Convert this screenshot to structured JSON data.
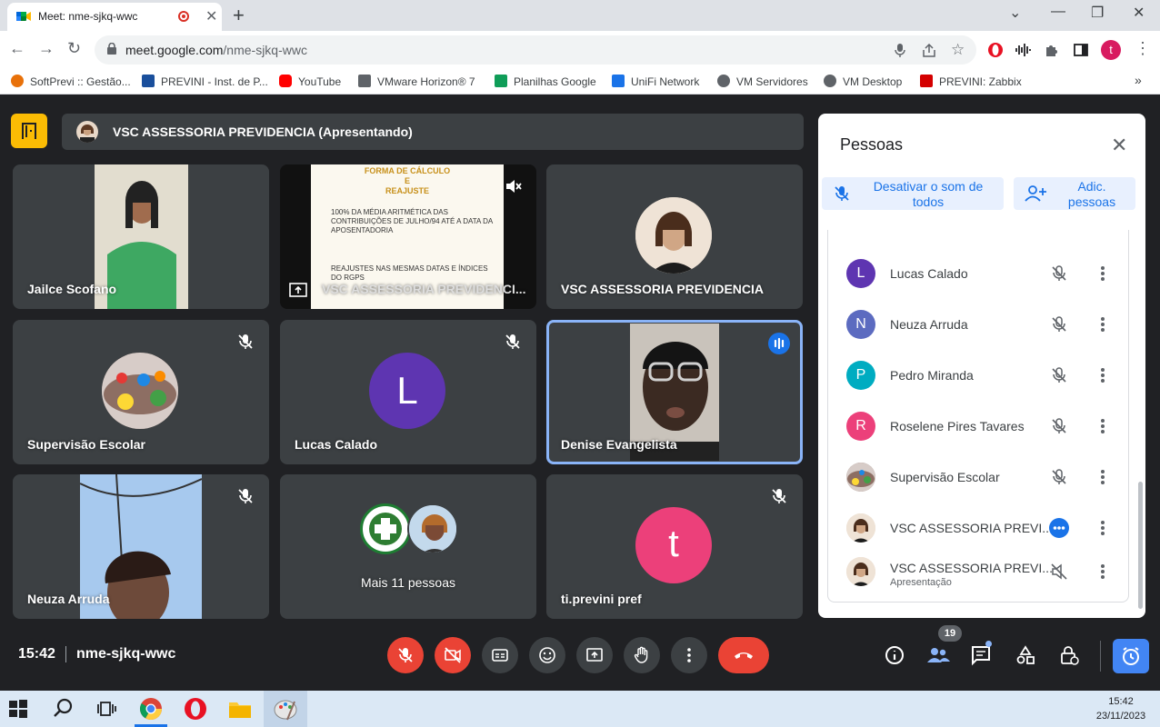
{
  "browser": {
    "tab_title": "Meet: nme-sjkq-wwc",
    "url_domain": "meet.google.com",
    "url_path": "/nme-sjkq-wwc",
    "profile_initial": "t",
    "bookmarks": [
      {
        "label": "SoftPrevi :: Gestão...",
        "color": "#e8710a"
      },
      {
        "label": "PREVINI - Inst. de P...",
        "color": "#1a4f9c"
      },
      {
        "label": "YouTube",
        "color": "#ff0000"
      },
      {
        "label": "VMware Horizon® 7",
        "color": "#5f6368"
      },
      {
        "label": "Planilhas Google",
        "color": "#0f9d58"
      },
      {
        "label": "UniFi Network",
        "color": "#1a73e8"
      },
      {
        "label": "VM Servidores",
        "color": "#5f6368"
      },
      {
        "label": "VM Desktop",
        "color": "#5f6368"
      },
      {
        "label": "PREVINI: Zabbix",
        "color": "#d40000"
      }
    ]
  },
  "meet": {
    "presenting_banner": "VSC ASSESSORIA PREVIDENCIA (Apresentando)",
    "tiles": [
      {
        "name": "Jailce Scofano"
      },
      {
        "name": "VSC ASSESSORIA PREVIDENCI..."
      },
      {
        "name": "VSC ASSESSORIA PREVIDENCIA"
      },
      {
        "name": "Supervisão Escolar"
      },
      {
        "name": "Lucas Calado",
        "initial": "L",
        "color": "#5e35b1"
      },
      {
        "name": "Denise Evangelista"
      },
      {
        "name": "Neuza Arruda"
      },
      {
        "name": "Mais 11 pessoas"
      },
      {
        "name": "ti.previni pref",
        "initial": "t",
        "color": "#ec407a"
      }
    ],
    "slide": {
      "title_lines": [
        "FORMA DE CÁLCULO",
        "E",
        "REAJUSTE"
      ],
      "bullet1": "100% DA MÉDIA ARITMÉTICA DAS CONTRIBUIÇÕES DE JULHO/94 ATÉ A DATA DA APOSENTADORIA",
      "bullet2": "REAJUSTES NAS MESMAS DATAS E ÍNDICES DO RGPS"
    },
    "time": "15:42",
    "meeting_code": "nme-sjkq-wwc",
    "participants_count": "19"
  },
  "people_panel": {
    "title": "Pessoas",
    "mute_all_label": "Desativar o som de todos",
    "add_people_label": "Adic. pessoas",
    "people": [
      {
        "name": "Lucas Calado",
        "initial": "L",
        "color": "#5e35b1",
        "mic": "muted"
      },
      {
        "name": "Neuza Arruda",
        "initial": "N",
        "color": "#5c6bc0",
        "mic": "muted"
      },
      {
        "name": "Pedro Miranda",
        "initial": "P",
        "color": "#00acc1",
        "mic": "muted"
      },
      {
        "name": "Roselene Pires Tavares",
        "initial": "R",
        "color": "#ec407a",
        "mic": "muted"
      },
      {
        "name": "Supervisão Escolar",
        "initial": "",
        "color": "#8d6e63",
        "mic": "muted"
      },
      {
        "name": "VSC ASSESSORIA PREVI...",
        "initial": "",
        "color": "#e8d8c8",
        "mic": "speaking"
      },
      {
        "name": "VSC ASSESSORIA PREVI...",
        "subtitle": "Apresentação",
        "initial": "",
        "color": "#e8d8c8",
        "mic": "presentation-muted"
      }
    ]
  },
  "taskbar": {
    "time": "15:42",
    "date": "23/11/2023"
  }
}
